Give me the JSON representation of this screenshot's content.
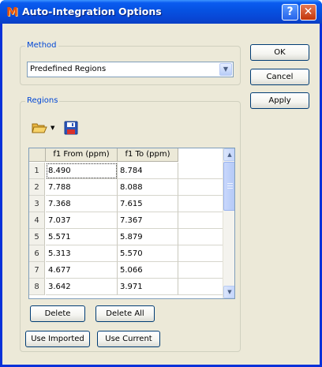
{
  "window": {
    "title": "Auto-Integration Options",
    "help_glyph": "?",
    "close_glyph": "✕"
  },
  "method": {
    "legend": "Method",
    "selected": "Predefined Regions"
  },
  "buttons": {
    "ok": "OK",
    "cancel": "Cancel",
    "apply": "Apply",
    "delete": "Delete",
    "delete_all": "Delete All",
    "use_imported": "Use Imported",
    "use_current": "Use Current"
  },
  "regions": {
    "legend": "Regions",
    "columns": [
      "f1 From (ppm)",
      "f1 To (ppm)"
    ],
    "rows": [
      {
        "n": "1",
        "from": "8.490",
        "to": "8.784"
      },
      {
        "n": "2",
        "from": "7.788",
        "to": "8.088"
      },
      {
        "n": "3",
        "from": "7.368",
        "to": "7.615"
      },
      {
        "n": "4",
        "from": "7.037",
        "to": "7.367"
      },
      {
        "n": "5",
        "from": "5.571",
        "to": "5.879"
      },
      {
        "n": "6",
        "from": "5.313",
        "to": "5.570"
      },
      {
        "n": "7",
        "from": "4.677",
        "to": "5.066"
      },
      {
        "n": "8",
        "from": "3.642",
        "to": "3.971"
      }
    ]
  },
  "icons": {
    "open": "folder-open-icon",
    "save": "floppy-save-icon"
  },
  "colors": {
    "titlebar": "#0653e3",
    "group_label": "#0046d5",
    "dialog_bg": "#ece9d8"
  }
}
